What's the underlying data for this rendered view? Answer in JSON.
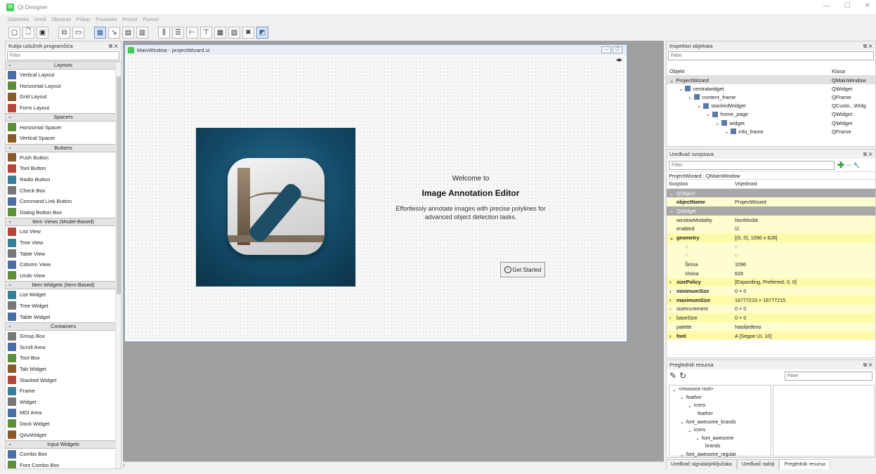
{
  "app": {
    "title": "Qt Designer",
    "icon_text": "Qt"
  },
  "menu": [
    "Datoteka",
    "Uredi",
    "Obrazac",
    "Prikaz",
    "Postavke",
    "Prozor",
    "Pomoć"
  ],
  "widgetbox": {
    "title": "Kutija uslužnih programčića",
    "filter_placeholder": "Filter",
    "sections": [
      {
        "label": "Layouts",
        "items": [
          "Vertical Layout",
          "Horizontal Layout",
          "Grid Layout",
          "Form Layout"
        ]
      },
      {
        "label": "Spacers",
        "items": [
          "Horizontal Spacer",
          "Vertical Spacer"
        ]
      },
      {
        "label": "Buttons",
        "items": [
          "Push Button",
          "Tool Button",
          "Radio Button",
          "Check Box",
          "Command Link Button",
          "Dialog Button Box"
        ]
      },
      {
        "label": "Item Views (Model-Based)",
        "items": [
          "List View",
          "Tree View",
          "Table View",
          "Column View",
          "Undo View"
        ]
      },
      {
        "label": "Item Widgets (Item-Based)",
        "items": [
          "List Widget",
          "Tree Widget",
          "Table Widget"
        ]
      },
      {
        "label": "Containers",
        "items": [
          "Group Box",
          "Scroll Area",
          "Tool Box",
          "Tab Widget",
          "Stacked Widget",
          "Frame",
          "Widget",
          "MDI Area",
          "Dock Widget",
          "QAxWidget"
        ]
      },
      {
        "label": "Input Widgets",
        "items": [
          "Combo Box",
          "Font Combo Box"
        ]
      }
    ]
  },
  "form": {
    "window_title": "MainWindow - projectWizard.ui",
    "welcome": "Welcome to",
    "heading": "Image Annotation Editor",
    "tagline_line1": "Effortlessly annotate images with precise polylines for",
    "tagline_line2": "advanced object detection tasks.",
    "button": "Get Started"
  },
  "inspector": {
    "title": "Inspektor objekata",
    "filter_placeholder": "Filter",
    "col_object": "Objekt",
    "col_class": "Klasa",
    "rows": [
      {
        "name": "ProjectWizard",
        "cls": "QMainWindow",
        "indent": 0
      },
      {
        "name": "centralwidget",
        "cls": "QWidget",
        "indent": 1
      },
      {
        "name": "content_frame",
        "cls": "QFrame",
        "indent": 2
      },
      {
        "name": "stackedWidget",
        "cls": "QCusto...Widg",
        "indent": 3
      },
      {
        "name": "home_page",
        "cls": "QWidget",
        "indent": 4
      },
      {
        "name": "widget",
        "cls": "QWidget",
        "indent": 5
      },
      {
        "name": "info_frame",
        "cls": "QFrame",
        "indent": 6
      }
    ]
  },
  "propeditor": {
    "title": "Uređivač svojstava",
    "filter_placeholder": "Filter",
    "object_line": "ProjectWizard : QMainWindow",
    "col_prop": "Svojstvo",
    "col_value": "Vrijednost",
    "rows": [
      {
        "k": "QObject",
        "v": "",
        "t": "grp"
      },
      {
        "k": "objectName",
        "v": "ProjectWizard",
        "t": "y bold"
      },
      {
        "k": "QWidget",
        "v": "",
        "t": "grp"
      },
      {
        "k": "windowModality",
        "v": "NonModal",
        "t": "y"
      },
      {
        "k": "enabled",
        "v": "☑",
        "t": "y"
      },
      {
        "k": "geometry",
        "v": "[(0, 0), 1096 x 628]",
        "t": "y2 bold exp"
      },
      {
        "k": "X",
        "v": "0",
        "t": "y sub"
      },
      {
        "k": "Y",
        "v": "0",
        "t": "y sub"
      },
      {
        "k": "Širina",
        "v": "1096",
        "t": "y subn"
      },
      {
        "k": "Visina",
        "v": "628",
        "t": "y subn"
      },
      {
        "k": "sizePolicy",
        "v": "[Expanding, Preferred, 0, 0]",
        "t": "y2 bold exp"
      },
      {
        "k": "minimumSize",
        "v": "0 × 0",
        "t": "y bold exp"
      },
      {
        "k": "maximumSize",
        "v": "16777215 × 16777215",
        "t": "y2 bold exp"
      },
      {
        "k": "sizeIncrement",
        "v": "0 × 0",
        "t": "y exp"
      },
      {
        "k": "baseSize",
        "v": "0 × 0",
        "t": "y2 exp"
      },
      {
        "k": "palette",
        "v": "Naslijeđeno",
        "t": "y"
      },
      {
        "k": "font",
        "v": "A  [Segoe UI, 10]",
        "t": "y2 bold exp"
      }
    ]
  },
  "resources": {
    "title": "Preglednik resursa",
    "filter_placeholder": "Filter",
    "tree": [
      {
        "label": "<resource root>",
        "indent": 0,
        "caret": "⌄"
      },
      {
        "label": "feather",
        "indent": 1,
        "caret": "⌄"
      },
      {
        "label": "icons",
        "indent": 2,
        "caret": "⌄"
      },
      {
        "label": "feather",
        "indent": 3,
        "caret": ""
      },
      {
        "label": "font_awesome_brands",
        "indent": 1,
        "caret": "⌄"
      },
      {
        "label": "icons",
        "indent": 2,
        "caret": "⌄"
      },
      {
        "label": "font_awesome",
        "indent": 3,
        "caret": "⌄"
      },
      {
        "label": "brands",
        "indent": 4,
        "caret": ""
      },
      {
        "label": "font_awesome_regular",
        "indent": 1,
        "caret": "⌄"
      }
    ]
  },
  "bottom_tabs": [
    "Uređivač signala/priključaka",
    "Uređivač radnji",
    "Preglednik resursa"
  ],
  "accent": "#41cd52"
}
